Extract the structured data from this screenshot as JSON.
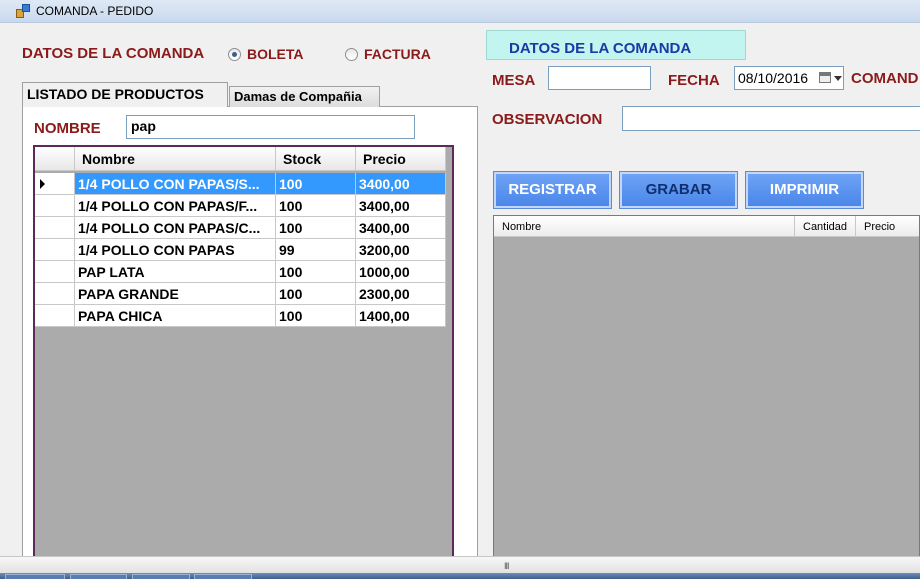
{
  "window": {
    "title": "COMANDA - PEDIDO"
  },
  "left": {
    "section_label": "DATOS DE LA COMANDA",
    "radio_boleta": "BOLETA",
    "radio_factura": "FACTURA",
    "selected_doc": "BOLETA",
    "tabs": [
      {
        "label": "LISTADO DE PRODUCTOS",
        "active": true
      },
      {
        "label": "Damas de Compañia",
        "active": false
      }
    ],
    "nombre_label": "NOMBRE",
    "nombre_value": "pap",
    "grid": {
      "columns": [
        "Nombre",
        "Stock",
        "Precio"
      ],
      "rows": [
        {
          "nombre": "1/4 POLLO CON PAPAS/S...",
          "stock": "100",
          "precio": "3400,00",
          "selected": true
        },
        {
          "nombre": "1/4 POLLO CON PAPAS/F...",
          "stock": "100",
          "precio": "3400,00"
        },
        {
          "nombre": "1/4 POLLO CON PAPAS/C...",
          "stock": "100",
          "precio": "3400,00"
        },
        {
          "nombre": "1/4 POLLO CON PAPAS",
          "stock": "99",
          "precio": "3200,00"
        },
        {
          "nombre": "PAP LATA",
          "stock": "100",
          "precio": "1000,00"
        },
        {
          "nombre": "PAPA GRANDE",
          "stock": "100",
          "precio": "2300,00"
        },
        {
          "nombre": "PAPA CHICA",
          "stock": "100",
          "precio": "1400,00"
        }
      ]
    }
  },
  "right": {
    "header": "DATOS DE LA COMANDA",
    "mesa_label": "MESA",
    "mesa_value": "",
    "fecha_label": "FECHA",
    "fecha_value": "08/10/2016",
    "comanda_label": "COMAND",
    "observacion_label": "OBSERVACION",
    "observacion_value": "",
    "buttons": {
      "registrar": "REGISTRAR",
      "grabar": "GRABAR",
      "imprimir": "IMPRIMIR"
    },
    "grid_columns": [
      "Nombre",
      "Cantidad",
      "Precio"
    ]
  },
  "scrollbar": {
    "grip": "III"
  },
  "colors": {
    "label": "#8b1a1a",
    "button": "#5a8fee",
    "header_bg": "#c2f4f0",
    "selection": "#3399ff"
  }
}
